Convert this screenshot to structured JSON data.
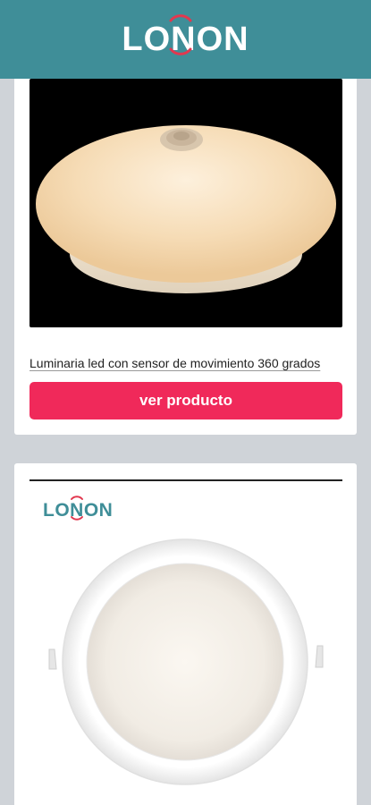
{
  "header": {
    "logo_text": "LONON"
  },
  "colors": {
    "header_bg": "#3f8e98",
    "page_bg": "#cfd3d8",
    "button_bg": "#f0295a",
    "logo_accent": "#e2384f"
  },
  "products": [
    {
      "title": "Luminaria led con sensor de movimiento 360 grados",
      "button_label": "ver producto",
      "image": "ceiling-light-with-motion-sensor"
    },
    {
      "brand_text": "LONON",
      "image": "round-led-panel-downlight"
    }
  ]
}
